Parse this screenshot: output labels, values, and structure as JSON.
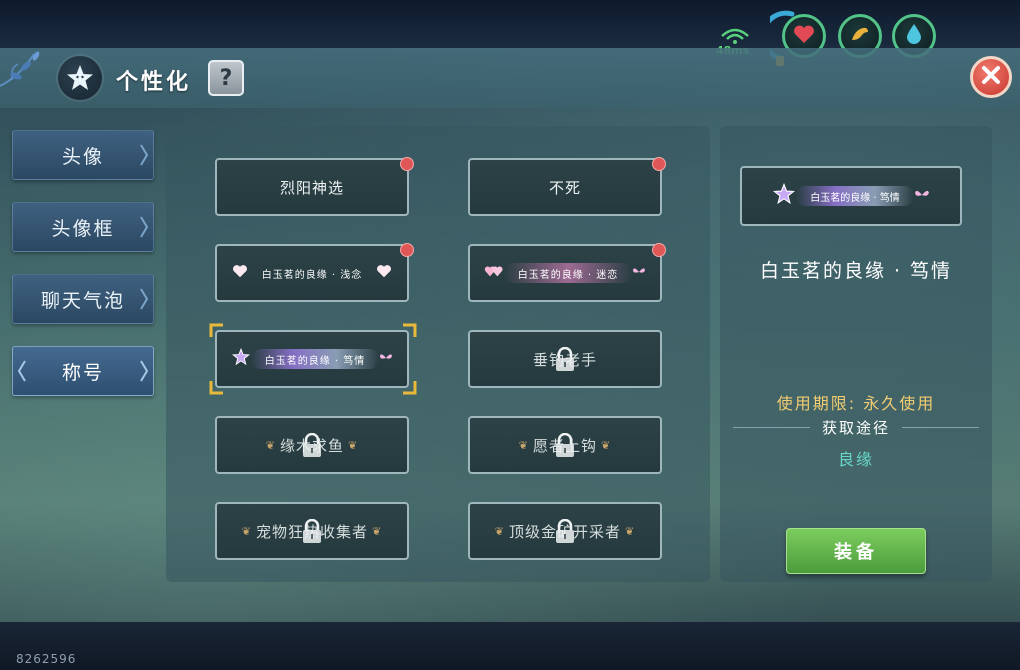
{
  "hud": {
    "ping": "48ms",
    "status_icons": [
      "heart-icon",
      "muscle-icon",
      "water-drop-icon"
    ]
  },
  "header": {
    "title": "个性化",
    "help_label": "?",
    "close_label": "✕"
  },
  "sidebar": {
    "items": [
      {
        "label": "头像",
        "active": false
      },
      {
        "label": "头像框",
        "active": false
      },
      {
        "label": "聊天气泡",
        "active": false
      },
      {
        "label": "称号",
        "active": true
      }
    ]
  },
  "titles": [
    {
      "label": "烈阳神选",
      "locked": false,
      "new": true
    },
    {
      "label": "不死",
      "locked": false,
      "new": true
    },
    {
      "label": "白玉茗的良缘 · 浅念",
      "locked": false,
      "new": true
    },
    {
      "label": "白玉茗的良缘 · 迷恋",
      "locked": false,
      "new": true
    },
    {
      "label": "白玉茗的良缘 · 笃情",
      "locked": false,
      "new": false,
      "selected": true
    },
    {
      "label": "垂钓老手",
      "locked": true,
      "new": false
    },
    {
      "label": "缘木求鱼",
      "locked": true,
      "new": false
    },
    {
      "label": "愿者上钩",
      "locked": true,
      "new": false
    },
    {
      "label": "宠物狂热收集者",
      "locked": true,
      "new": false
    },
    {
      "label": "顶级金矿开采者",
      "locked": true,
      "new": false
    }
  ],
  "detail": {
    "preview_label": "白玉茗的良缘 · 笃情",
    "name": "白玉茗的良缘 · 笃情",
    "period": "使用期限: 永久使用",
    "acquire_label": "获取途径",
    "source": "良缘",
    "equip_label": "装备"
  },
  "footer": {
    "version": "8262596"
  },
  "colors": {
    "accent_green": "#52c489",
    "period_gold": "#f1cd72",
    "source_teal": "#66d6c8",
    "new_dot": "#e05757",
    "close_red": "#c8362e"
  }
}
